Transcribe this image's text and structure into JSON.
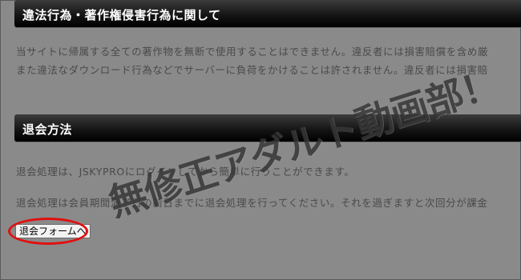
{
  "sections": [
    {
      "title": "違法行為・著作権侵害行為に関して",
      "lines": [
        "当サイトに帰属する全ての著作物を無断で使用することはできません。違反者には損害賠償を含め厳",
        "また違法なダウンロード行為などでサーバーに負荷をかけることは許されません。違反者には損害賠"
      ]
    },
    {
      "title": "退会方法",
      "lines": [
        "退会処理は、JSKYPROにログインしてから簡単に行うことができます。",
        "退会処理は会員期間満了日の前日までに退会処理を行ってください。それを過ぎますと次回分が課金"
      ]
    }
  ],
  "withdraw_button": {
    "label": "退会フォームへ"
  },
  "watermark": {
    "text": "無修正アダルト動画部！"
  },
  "colors": {
    "background": "#8a8a8a",
    "header_bg": "#000000",
    "highlight": "#e01010"
  }
}
